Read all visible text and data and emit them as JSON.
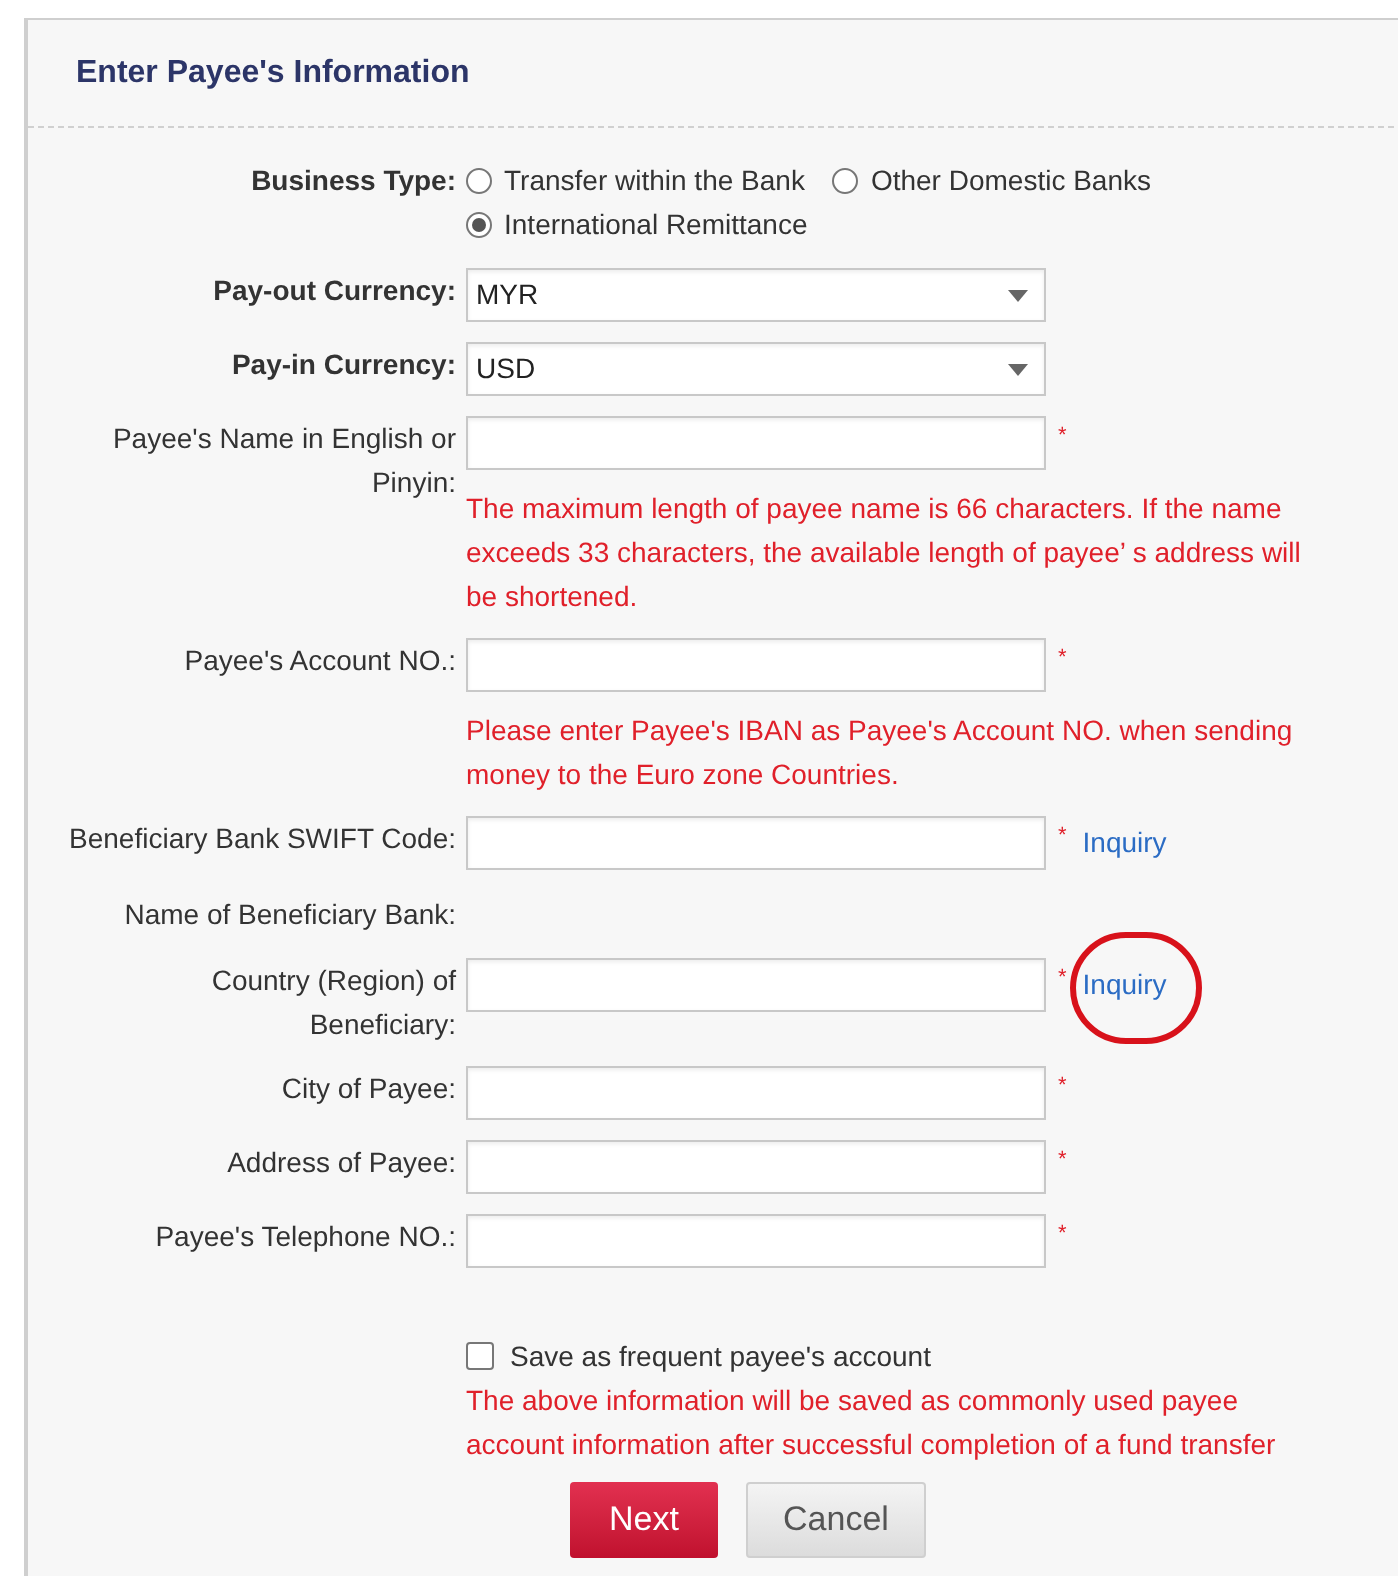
{
  "panel": {
    "title": "Enter Payee's Information"
  },
  "business_type": {
    "label": "Business Type:",
    "options": [
      {
        "label": "Transfer within the Bank",
        "selected": false
      },
      {
        "label": "Other Domestic Banks",
        "selected": false
      },
      {
        "label": "International Remittance",
        "selected": true
      }
    ]
  },
  "fields": [
    {
      "kind": "select",
      "label": "Pay-out Currency:",
      "value": "MYR"
    },
    {
      "kind": "select",
      "label": "Pay-in Currency:",
      "value": "USD"
    },
    {
      "kind": "text",
      "label": "Payee's Name in English or Pinyin:",
      "required": "*",
      "note": "The maximum length of payee name is 66 characters. If the name exceeds 33 characters, the available length of payee’  s address will be shortened."
    },
    {
      "kind": "text",
      "label": "Payee's Account NO.:",
      "required": "*",
      "note": "Please enter Payee's IBAN as Payee's Account NO. when sending money to the Euro zone Countries."
    },
    {
      "kind": "text",
      "label": "Beneficiary Bank SWIFT Code:",
      "required": "*",
      "link": {
        "label": "Inquiry",
        "highlighted": false
      }
    },
    {
      "kind": "static",
      "label": "Name of Beneficiary Bank:"
    },
    {
      "kind": "text",
      "label": "Country (Region) of Beneficiary:",
      "required": "*",
      "link": {
        "label": "Inquiry",
        "highlighted": true
      }
    },
    {
      "kind": "text",
      "label": "City of Payee:",
      "required": "*"
    },
    {
      "kind": "text",
      "label": "Address of Payee:",
      "required": "*"
    },
    {
      "kind": "text",
      "label": "Payee's Telephone NO.:",
      "required": "*"
    }
  ],
  "save_option": {
    "label": "Save as frequent payee's account",
    "checked": false,
    "note": "The above information will be saved as commonly used payee account information after successful completion of a fund transfer"
  },
  "buttons": [
    {
      "label": "Next",
      "kind": "primary"
    },
    {
      "label": "Cancel",
      "kind": "secondary"
    }
  ]
}
